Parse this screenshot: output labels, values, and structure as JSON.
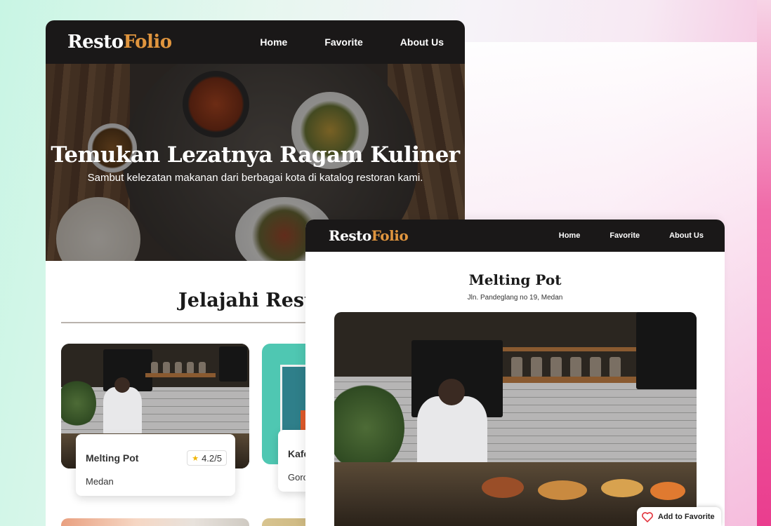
{
  "brand": {
    "part1": "Resto",
    "part2": "Folio"
  },
  "nav": {
    "home": "Home",
    "favorite": "Favorite",
    "about": "About Us"
  },
  "hero": {
    "title": "Temukan Lezatnya Ragam Kuliner",
    "subtitle": "Sambut kelezatan makanan dari berbagai kota di katalog restoran kami."
  },
  "explore": {
    "title": "Jelajahi Restor"
  },
  "restaurants": [
    {
      "name": "Melting Pot",
      "city": "Medan",
      "rating": "4.2/5"
    },
    {
      "name": "Kafe",
      "city": "Goro"
    }
  ],
  "detail": {
    "name": "Melting Pot",
    "address": "Jln. Pandeglang no 19, Medan",
    "favorite_label": "Add to Favorite"
  },
  "colors": {
    "nav_bg": "#1a1818",
    "brand_accent": "#e0953e",
    "star": "#f0b400"
  },
  "icons": {
    "rating": "star-icon",
    "favorite": "heart-outline-icon"
  }
}
